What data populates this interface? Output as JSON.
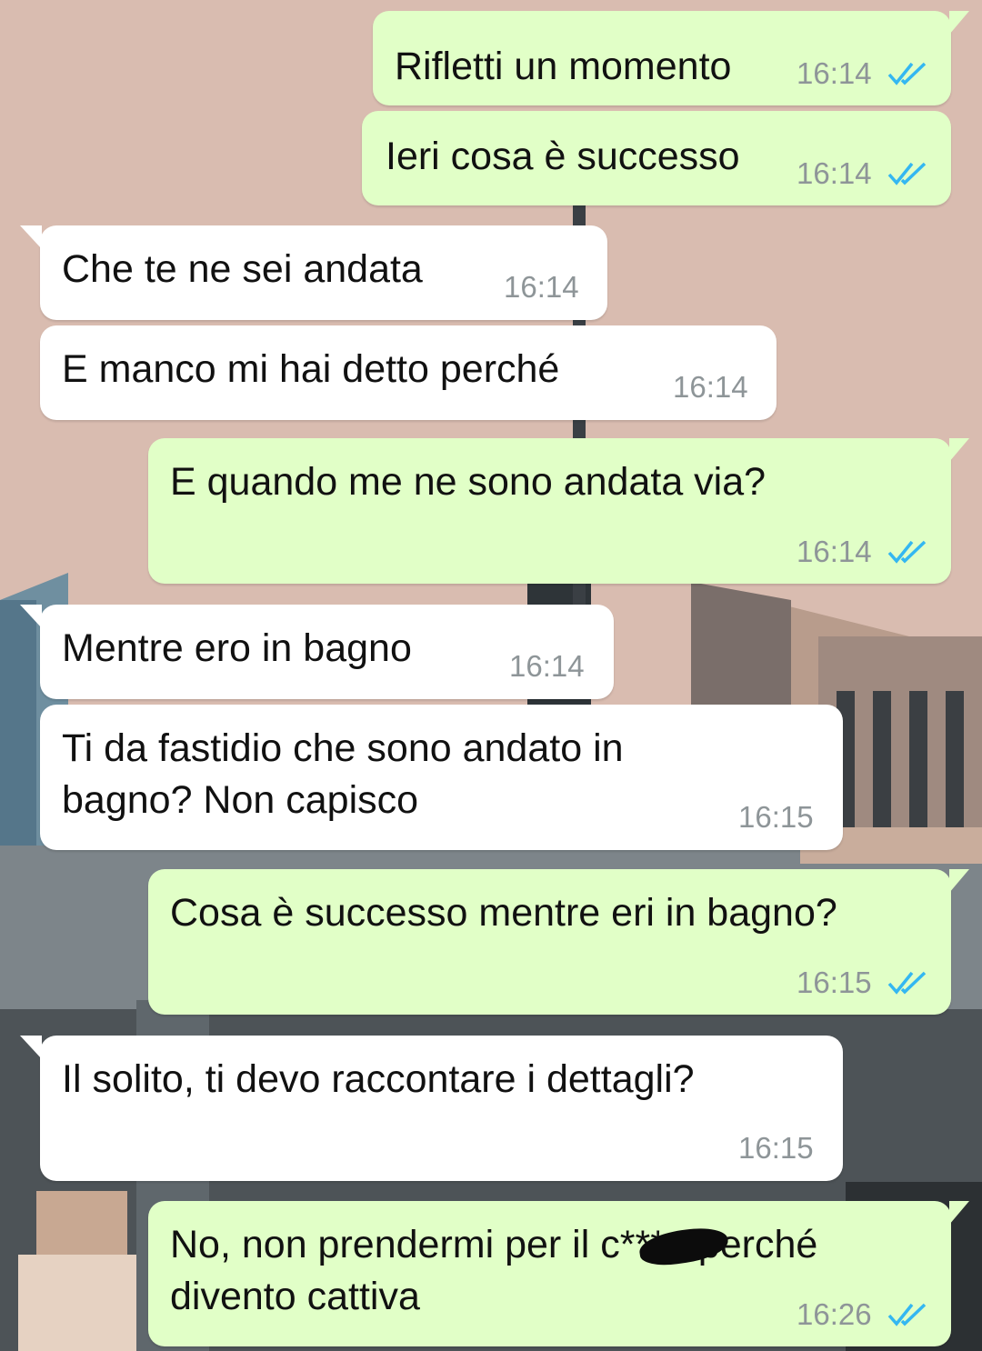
{
  "colors": {
    "outgoing_bubble": "#e1ffc7",
    "incoming_bubble": "#ffffff",
    "read_ticks": "#34b7f1",
    "timestamp": "#8e9598",
    "wallpaper_sky": "#d9bcb0"
  },
  "icons": {
    "read_receipt": "double-check-icon",
    "censor": "censor-blot"
  },
  "messages": [
    {
      "direction": "outgoing",
      "text": "Rifletti un momento",
      "time": "16:14",
      "status": "read"
    },
    {
      "direction": "outgoing",
      "text": "Ieri cosa è successo",
      "time": "16:14",
      "status": "read"
    },
    {
      "direction": "incoming",
      "text": "Che te ne sei andata",
      "time": "16:14"
    },
    {
      "direction": "incoming",
      "text": "E manco mi hai detto perché",
      "time": "16:14"
    },
    {
      "direction": "outgoing",
      "text": "E quando me ne sono andata via?",
      "time": "16:14",
      "status": "read"
    },
    {
      "direction": "incoming",
      "text": "Mentre ero in bagno",
      "time": "16:14"
    },
    {
      "direction": "incoming",
      "lines": [
        "Ti da fastidio che sono andato in",
        "bagno? Non capisco"
      ],
      "time": "16:15"
    },
    {
      "direction": "outgoing",
      "text": "Cosa è successo mentre eri in bagno?",
      "time": "16:15",
      "status": "read"
    },
    {
      "direction": "incoming",
      "text": "Il solito, ti devo raccontare i dettagli?",
      "time": "16:15"
    },
    {
      "direction": "outgoing",
      "lines": [
        "No, non prendermi per il c***o perché",
        "divento cattiva"
      ],
      "time": "16:26",
      "status": "read",
      "censored": true
    }
  ]
}
